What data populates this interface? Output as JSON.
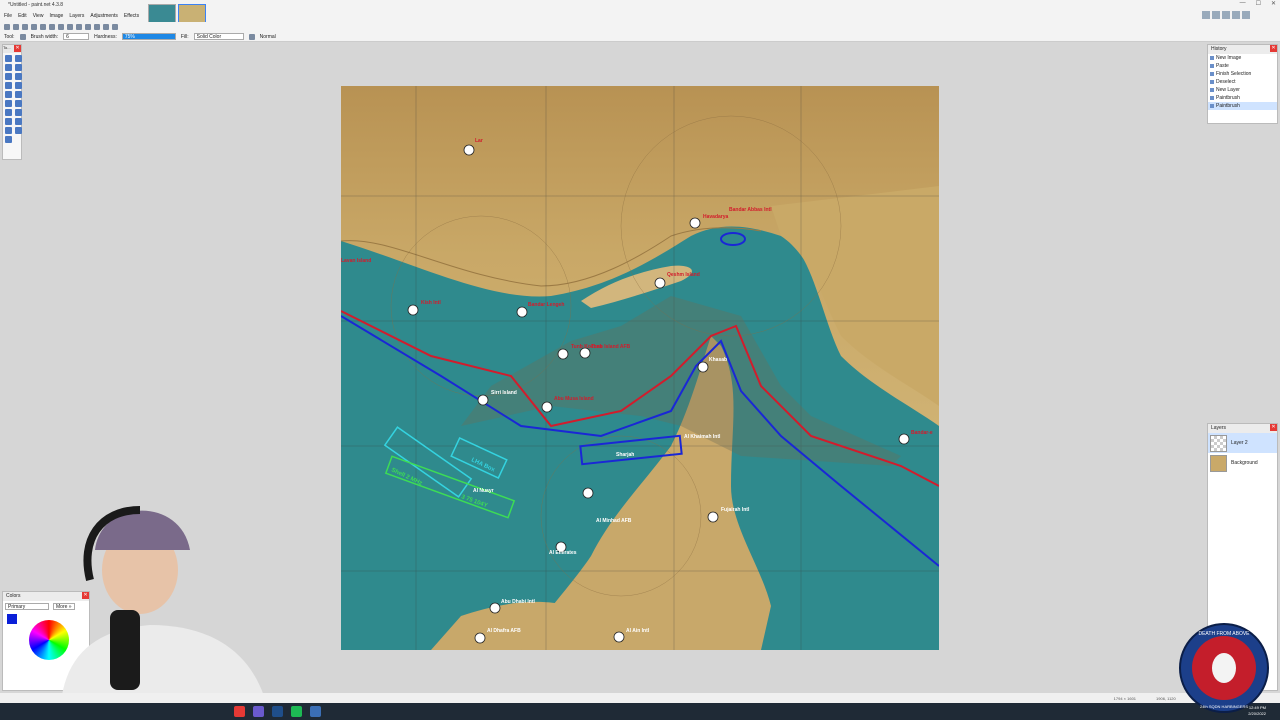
{
  "window": {
    "title": "*Untitled - paint.net 4.3.8",
    "controls": [
      "—",
      "☐",
      "✕"
    ]
  },
  "menu": [
    "File",
    "Edit",
    "View",
    "Image",
    "Layers",
    "Adjustments",
    "Effects"
  ],
  "options": {
    "tool_label": "Tool:",
    "brush_width_label": "Brush width:",
    "brush_width_value": "6",
    "hardness_label": "Hardness:",
    "hardness_value": "75%",
    "fill_label": "Fill:",
    "fill_value": "Solid Color",
    "blend_value": "Normal"
  },
  "tools_panel": {
    "title": "To..."
  },
  "history": {
    "title": "History",
    "items": [
      "New Image",
      "Paste",
      "Finish Selection",
      "Deselect",
      "New Layer",
      "Paintbrush",
      "Paintbrush"
    ]
  },
  "layers": {
    "title": "Layers",
    "items": [
      "Layer 2",
      "Background"
    ]
  },
  "colors": {
    "title": "Colors",
    "primary_label": "Primary",
    "more_label": "More »",
    "primary_color": "#0a1fd8"
  },
  "map": {
    "labels": [
      "Lar",
      "Bandar Abbas Intl",
      "Havadarya",
      "Lavan Island",
      "Qeshm Island",
      "Kish Intl",
      "Bandar Lengeh",
      "Tunb Kochak",
      "Tunb Island AFB",
      "Sirri Island",
      "Abu Musa Island",
      "Khasab",
      "Al Khaimah Intl",
      "Bandar-e",
      "LHA Box",
      "Shell 2 MHz",
      "3 75 104Y",
      "Al Minhad AFB",
      "Fujairah Intl",
      "Abu Dhabi Intl",
      "Al Dhafra AFB",
      "Al Ain Intl",
      "Sharjah",
      "Al Nuayr",
      "Al Emirates"
    ],
    "route_colors": {
      "red": "#d21c2c",
      "blue": "#1a27d6",
      "cyan": "#34d3e0",
      "green": "#3ddc55"
    }
  },
  "status": {
    "pos": "1794 × 1601",
    "size": "1906, 1120",
    "unit": "px"
  },
  "taskbar": {
    "time": "12:49 PM",
    "date": "2/20/2022"
  },
  "branding": {
    "logo_top": "DEATH FROM ABOVE",
    "logo_bottom": "24th SQDN HARBINGERS"
  }
}
